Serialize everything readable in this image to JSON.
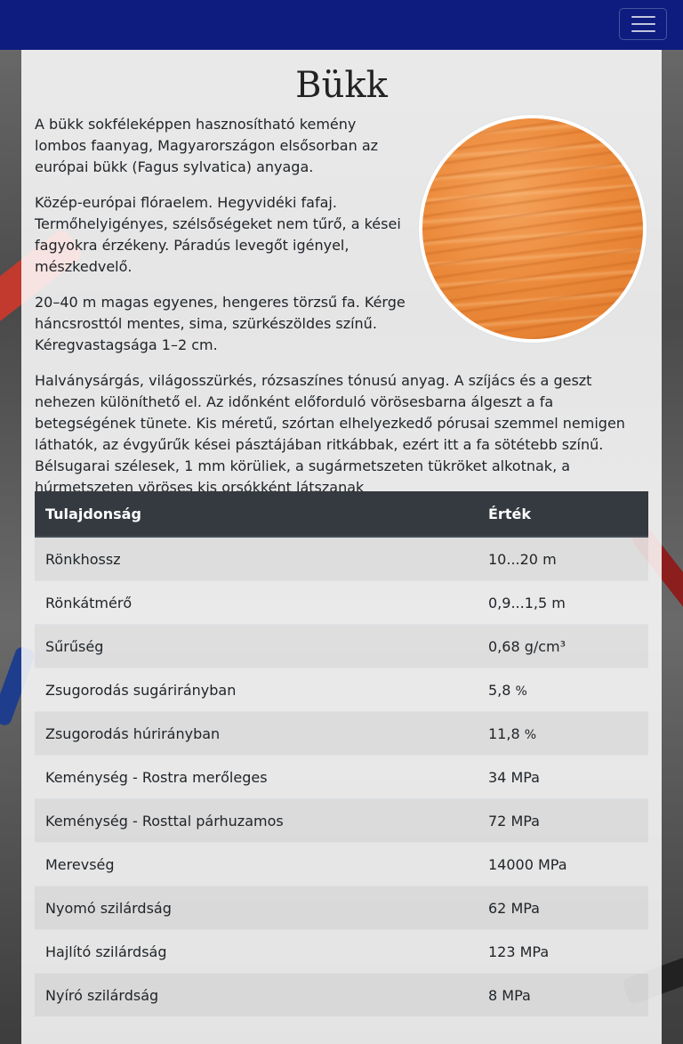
{
  "page": {
    "title": "Bükk",
    "paragraphs": [
      "A bükk sokféleképpen hasznosítható kemény lombos faanyag, Magyarországon elsősorban az európai bükk (Fagus sylvatica) anyaga.",
      "Közép-európai flóraelem. Hegyvidéki fafaj. Termőhelyigényes, szélsőségeket nem tűrő, a kései fagyokra érzékeny. Páradús levegőt igényel, mészkedvelő.",
      "20–40 m magas egyenes, hengeres törzsű fa. Kérge háncsrosttól mentes, sima, szürkészöldes színű. Kéregvastagsága 1–2 cm.",
      "Halványsárgás, világosszürkés, rózsaszínes tónusú anyag. A szíjács és a geszt nehezen különíthető el. Az időnként előforduló vörösesbarna álgeszt a fa betegségének tünete. Kis méretű, szórtan elhelyezkedő pórusai szemmel nemigen láthatók, az évgyűrűk kései pásztájában ritkábbak, ezért itt a fa sötétebb színű. Bélsugarai szélesek, 1 mm körüliek, a sugármetszeten tükröket alkotnak, a húrmetszeten vöröses kis orsókként látszanak"
    ]
  },
  "navbar": {
    "toggler_icon": "hamburger-icon",
    "color": "#0d1c7e"
  },
  "table": {
    "headers": [
      "Tulajdonság",
      "Érték"
    ],
    "rows": [
      {
        "name": "Rönkhossz",
        "value": "10...20 m",
        "unit": ""
      },
      {
        "name": "Rönkátmérő",
        "value": "0,9...1,5 m",
        "unit": ""
      },
      {
        "name": "Sűrűség",
        "value": "0,68 g/cm³",
        "unit": ""
      },
      {
        "name": "Zsugorodás sugárirányban",
        "value": "5,8 ",
        "unit": "%"
      },
      {
        "name": "Zsugorodás húrirányban",
        "value": "11,8 ",
        "unit": "%"
      },
      {
        "name": "Keménység - Rostra merőleges",
        "value": "34 MPa",
        "unit": ""
      },
      {
        "name": "Keménység - Rosttal párhuzamos",
        "value": "72 MPa",
        "unit": ""
      },
      {
        "name": "Merevség",
        "value": "14000 MPa",
        "unit": ""
      },
      {
        "name": "Nyomó szilárdság",
        "value": "62 MPa",
        "unit": ""
      },
      {
        "name": "Hajlító szilárdság",
        "value": "123 MPa",
        "unit": ""
      },
      {
        "name": "Nyíró szilárdság",
        "value": "8 MPa",
        "unit": ""
      }
    ]
  }
}
